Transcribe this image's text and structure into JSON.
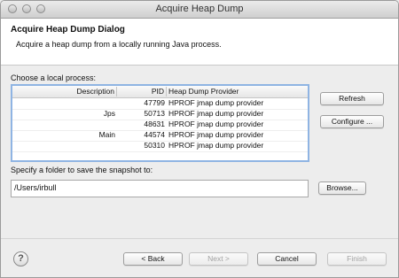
{
  "window": {
    "title": "Acquire Heap Dump"
  },
  "header": {
    "title": "Acquire Heap Dump Dialog",
    "description": "Acquire a heap dump from a locally running Java process."
  },
  "process_section": {
    "label": "Choose a local process:",
    "columns": [
      "Description",
      "PID",
      "Heap Dump Provider"
    ],
    "rows": [
      {
        "description": "",
        "pid": "47799",
        "provider": "HPROF jmap dump provider"
      },
      {
        "description": "Jps",
        "pid": "50713",
        "provider": "HPROF jmap dump provider"
      },
      {
        "description": "",
        "pid": "48631",
        "provider": "HPROF jmap dump provider"
      },
      {
        "description": "Main",
        "pid": "44574",
        "provider": "HPROF jmap dump provider"
      },
      {
        "description": "",
        "pid": "50310",
        "provider": "HPROF jmap dump provider"
      }
    ],
    "refresh_label": "Refresh",
    "configure_label": "Configure ..."
  },
  "folder_section": {
    "label": "Specify a folder to save the snapshot to:",
    "value": "/Users/irbull",
    "browse_label": "Browse..."
  },
  "footer": {
    "help_symbol": "?",
    "back_label": "< Back",
    "next_label": "Next >",
    "cancel_label": "Cancel",
    "finish_label": "Finish"
  },
  "icons": {
    "traffic_close": "close-icon",
    "traffic_min": "minimize-icon",
    "traffic_zoom": "zoom-icon",
    "help": "help-icon"
  },
  "colors": {
    "selection_border": "#8fb4e3",
    "header_bg": "#ffffff",
    "dialog_bg": "#ededed"
  }
}
